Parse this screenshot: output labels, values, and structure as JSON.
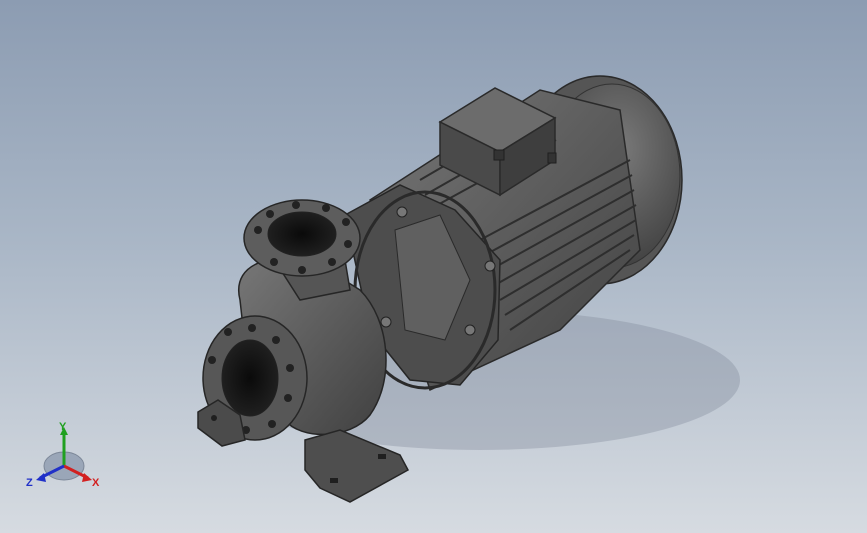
{
  "viewport": {
    "background_top": "#8c9cb2",
    "background_bottom": "#d6dbe1",
    "model_color": "#5a5a5a"
  },
  "triad": {
    "x_label": "X",
    "y_label": "Y",
    "z_label": "Z",
    "x_color": "#d22020",
    "y_color": "#20a020",
    "z_color": "#2030c8"
  }
}
